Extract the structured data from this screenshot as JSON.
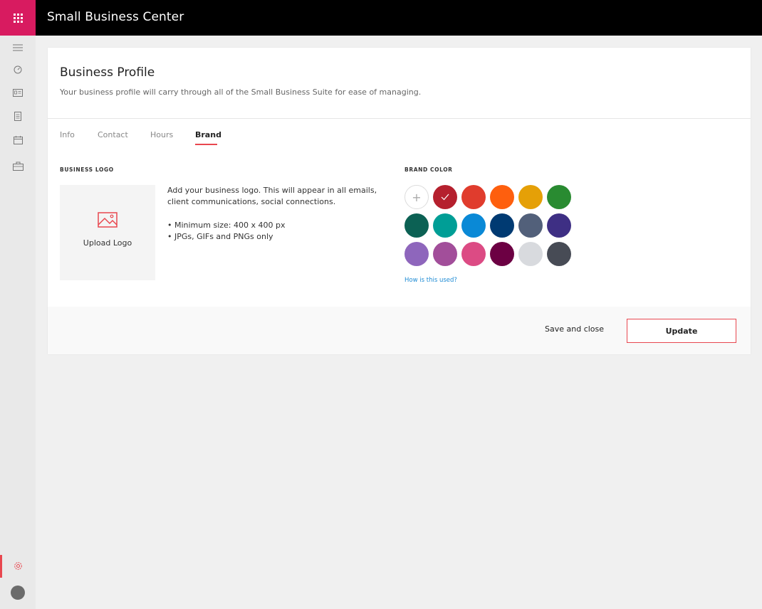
{
  "app": {
    "title": "Small Business Center"
  },
  "rail": {
    "items": [
      {
        "icon": "hamburger-icon"
      },
      {
        "icon": "dashboard-icon"
      },
      {
        "icon": "contact-card-icon"
      },
      {
        "icon": "document-icon"
      },
      {
        "icon": "calendar-icon"
      },
      {
        "icon": "briefcase-icon"
      }
    ],
    "active_item": {
      "icon": "settings-icon"
    },
    "accent_color": "#e8474f"
  },
  "profile": {
    "title": "Business Profile",
    "subtitle": "Your business profile will carry through all of the Small Business Suite for ease of managing.",
    "tabs": [
      {
        "label": "Info"
      },
      {
        "label": "Contact"
      },
      {
        "label": "Hours"
      },
      {
        "label": "Brand",
        "active": true
      }
    ]
  },
  "logo": {
    "section_label": "BUSINESS LOGO",
    "upload_label": "Upload Logo",
    "description": "Add your business logo. This will appear in all emails, client communications, social connections.",
    "bullets": [
      "• Minimum size: 400 x 400 px",
      "• JPGs, GIFs and PNGs only"
    ]
  },
  "brand": {
    "section_label": "BRAND COLOR",
    "selected_color": "#b5202e",
    "colors": [
      [
        "add",
        "#b5202e",
        "#e03c2d",
        "#fe5f0e",
        "#e5a007",
        "#298b31"
      ],
      [
        "#0c6154",
        "#009e96",
        "#0a89d6",
        "#003a72",
        "#52607a",
        "#3e2f84"
      ],
      [
        "#8e66bc",
        "#a24e9a",
        "#dc4b84",
        "#6c0043",
        "#d8dade",
        "#474b55"
      ]
    ],
    "help_link": "How is this used?"
  },
  "footer": {
    "save_close_label": "Save and close",
    "update_label": "Update"
  }
}
